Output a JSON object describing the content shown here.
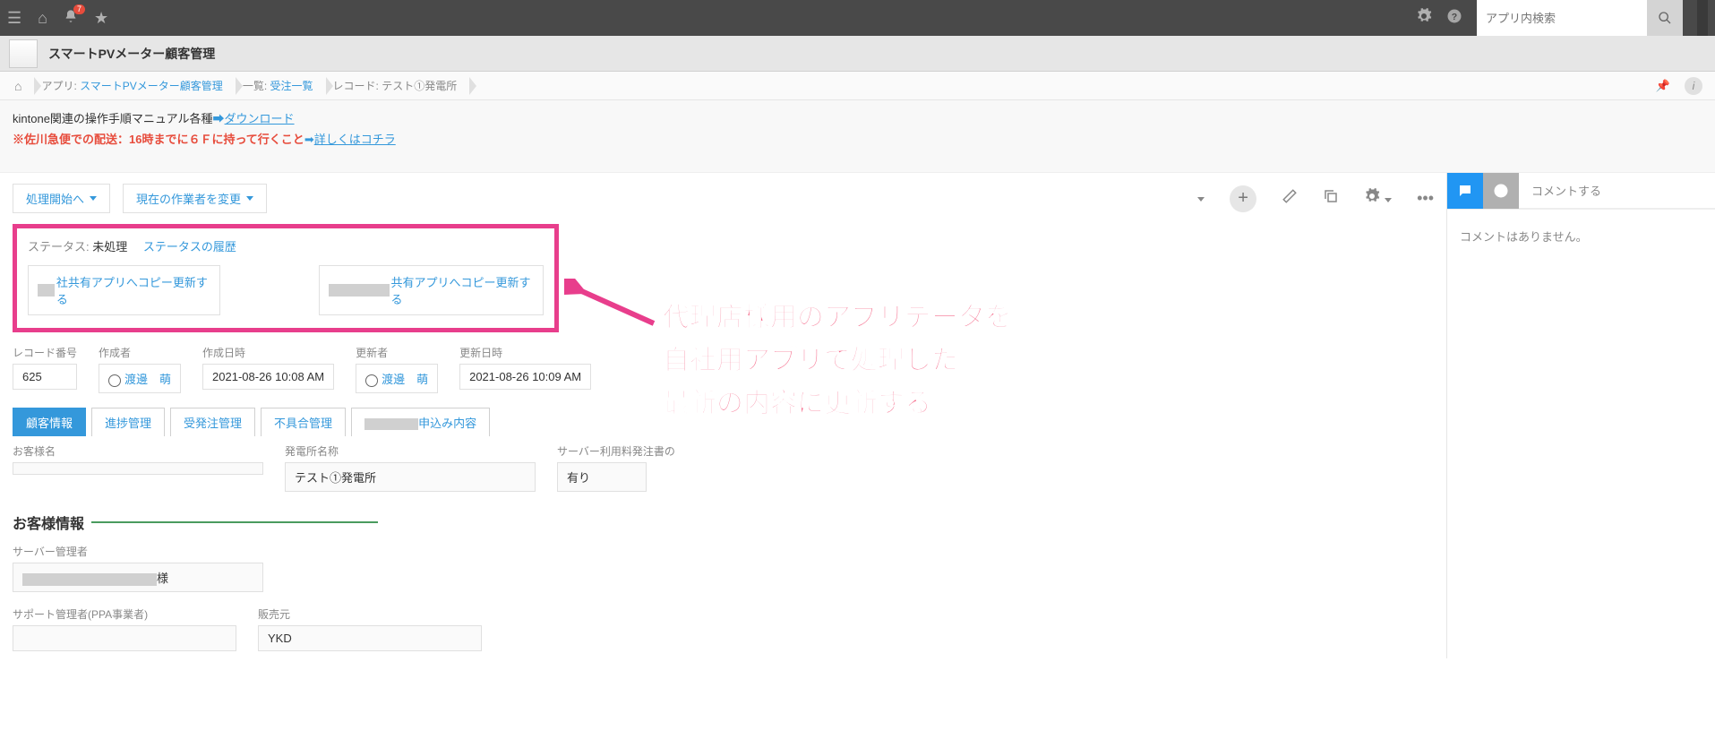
{
  "globalBar": {
    "notificationCount": "7",
    "searchPlaceholder": "アプリ内検索"
  },
  "appHeader": {
    "title": "スマートPVメーター顧客管理"
  },
  "breadcrumb": {
    "appLabel": "アプリ:",
    "appName": "スマートPVメーター顧客管理",
    "listLabel": "一覧:",
    "listName": "受注一覧",
    "recordLabel": "レコード:",
    "recordName": "テスト①発電所"
  },
  "notice": {
    "line1Text": "kintone関連の操作手順マニュアル各種",
    "line1Link": "ダウンロード",
    "line2Red": "※佐川急便での配送：16時までに６Ｆに持って行くこと",
    "line2Link": "詳しくはコチラ"
  },
  "actions": {
    "startProcess": "処理開始へ",
    "changeWorker": "現在の作業者を変更"
  },
  "status": {
    "label": "ステータス:",
    "value": "未処理",
    "historyLink": "ステータスの履歴",
    "copyBtn1": "社共有アプリへコピー更新する",
    "copyBtn2": "共有アプリへコピー更新する"
  },
  "annotation": {
    "line1": "代理店様用のアプリデータを",
    "line2": "自社用アプリで処理した",
    "line3": "最新の内容に更新する"
  },
  "recordInfo": {
    "recordNoLabel": "レコード番号",
    "recordNo": "625",
    "creatorLabel": "作成者",
    "creatorName": "渡邊　萌",
    "createdAtLabel": "作成日時",
    "createdAt": "2021-08-26 10:08 AM",
    "updaterLabel": "更新者",
    "updaterName": "渡邊　萌",
    "updatedAtLabel": "更新日時",
    "updatedAt": "2021-08-26 10:09 AM"
  },
  "tabs": {
    "t1": "顧客情報",
    "t2": "進捗管理",
    "t3": "受発注管理",
    "t4": "不具合管理",
    "t5suffix": "申込み内容"
  },
  "form": {
    "customerNameLabel": "お客様名",
    "customerName": "",
    "plantNameLabel": "発電所名称",
    "plantName": "テスト①発電所",
    "serverOrderLabel": "サーバー利用料発注書の",
    "serverOrder": "有り",
    "sectionTitle": "お客様情報",
    "serverAdminLabel": "サーバー管理者",
    "serverAdminSuffix": "様",
    "supportAdminLabel": "サポート管理者(PPA事業者)",
    "sellerLabel": "販売元",
    "seller": "YKD"
  },
  "comments": {
    "header": "コメントする",
    "empty": "コメントはありません。"
  }
}
